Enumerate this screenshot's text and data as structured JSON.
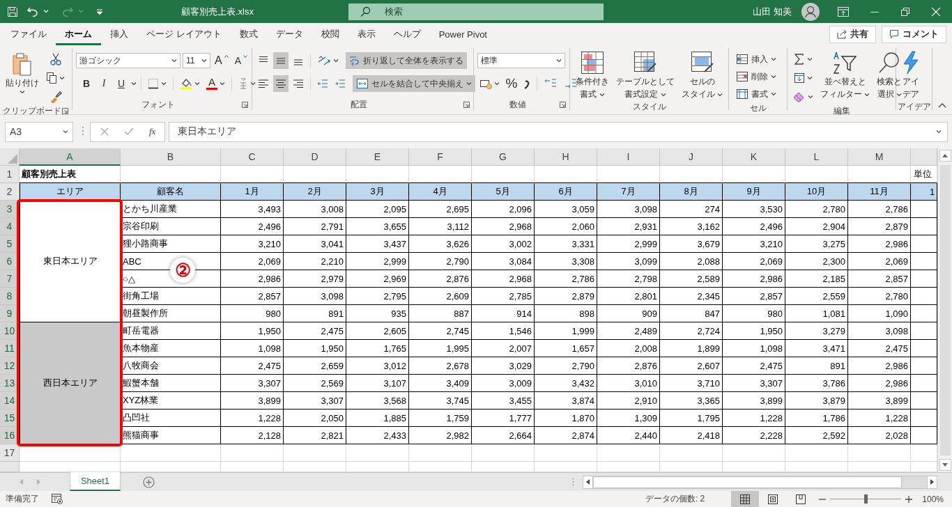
{
  "title_bar": {
    "file_name": "顧客別売上表.xlsx",
    "search": {
      "placeholder": "検索"
    },
    "user_name": "山田 知美"
  },
  "menu_tabs": [
    {
      "label": "ファイル",
      "selected": false
    },
    {
      "label": "ホーム",
      "selected": true
    },
    {
      "label": "挿入",
      "selected": false
    },
    {
      "label": "ページ レイアウト",
      "selected": false
    },
    {
      "label": "数式",
      "selected": false
    },
    {
      "label": "データ",
      "selected": false
    },
    {
      "label": "校閲",
      "selected": false
    },
    {
      "label": "表示",
      "selected": false
    },
    {
      "label": "ヘルプ",
      "selected": false
    },
    {
      "label": "Power Pivot",
      "selected": false
    }
  ],
  "share_button": "共有",
  "comment_button": "コメント",
  "ribbon": {
    "groups": [
      {
        "kind": "clipboard",
        "label": "クリップボード",
        "paste": "貼り付け"
      },
      {
        "kind": "font",
        "label": "フォント",
        "font_name": "游ゴシック",
        "font_size": "11",
        "grow": "A",
        "shrink": "A",
        "styles": [
          "B",
          "I",
          "U"
        ],
        "font_color": "A"
      },
      {
        "kind": "alignment",
        "label": "配置",
        "vertical": [
          {
            "selected": false
          },
          {
            "selected": true
          },
          {
            "selected": false
          }
        ],
        "horizontal": [
          {
            "selected": false
          },
          {
            "selected": true
          },
          {
            "selected": false
          }
        ],
        "wrap_text": {
          "label": "折り返して全体を表示する",
          "on": true
        },
        "merge": {
          "label": "セルを結合して中央揃え",
          "on": true
        }
      },
      {
        "kind": "number",
        "label": "数値",
        "format": "標準",
        "percent": "%"
      },
      {
        "kind": "styles",
        "label": "スタイル",
        "buttons": [
          {
            "lines": [
              "条件付き",
              "書式"
            ]
          },
          {
            "lines": [
              "テーブルとして",
              "書式設定"
            ]
          },
          {
            "lines": [
              "セルの",
              "スタイル"
            ]
          }
        ]
      },
      {
        "kind": "cells",
        "label": "セル",
        "buttons": [
          "挿入",
          "削除",
          "書式"
        ]
      },
      {
        "kind": "editing",
        "label": "編集",
        "buttons": [
          {
            "lines": [
              "並べ替えと",
              "フィルター"
            ]
          },
          {
            "lines": [
              "検索と",
              "選択"
            ]
          }
        ]
      },
      {
        "kind": "ideas",
        "label": "アイデア",
        "buttons": [
          {
            "lines": [
              "アイ",
              "デア"
            ]
          }
        ]
      }
    ]
  },
  "formula_bar": {
    "name_box": "A3",
    "function_label": "fx",
    "formula": "東日本エリア"
  },
  "sheet": {
    "columns": [
      {
        "label": "A",
        "selected": true
      },
      {
        "label": "B",
        "selected": false
      },
      {
        "label": "C",
        "selected": false
      },
      {
        "label": "D",
        "selected": false
      },
      {
        "label": "E",
        "selected": false
      },
      {
        "label": "F",
        "selected": false
      },
      {
        "label": "G",
        "selected": false
      },
      {
        "label": "H",
        "selected": false
      },
      {
        "label": "I",
        "selected": false
      },
      {
        "label": "J",
        "selected": false
      },
      {
        "label": "K",
        "selected": false
      },
      {
        "label": "L",
        "selected": false
      },
      {
        "label": "M",
        "selected": false
      }
    ],
    "title_row": {
      "number": "1",
      "selected": false,
      "title": "顧客別売上表",
      "unit": "単位"
    },
    "header_row": {
      "number": "2",
      "selected": false,
      "cells": [
        "エリア",
        "顧客名",
        "1月",
        "2月",
        "3月",
        "4月",
        "5月",
        "6月",
        "7月",
        "8月",
        "9月",
        "10月",
        "11月",
        "1"
      ]
    },
    "areas": [
      {
        "name": "東日本エリア",
        "shaded": false,
        "rows": [
          {
            "number": "3",
            "selected": true,
            "customer": "とかち川産業",
            "values": [
              "3,493",
              "3,008",
              "2,095",
              "2,695",
              "2,096",
              "3,059",
              "3,098",
              "274",
              "3,530",
              "2,780",
              "2,786"
            ]
          },
          {
            "number": "4",
            "selected": true,
            "customer": "宗谷印刷",
            "values": [
              "2,496",
              "2,791",
              "3,655",
              "3,112",
              "2,968",
              "2,060",
              "2,931",
              "3,162",
              "2,496",
              "2,904",
              "2,879"
            ]
          },
          {
            "number": "5",
            "selected": true,
            "customer": "狸小路商事",
            "values": [
              "3,210",
              "3,041",
              "3,437",
              "3,626",
              "3,002",
              "3,331",
              "2,999",
              "3,679",
              "3,210",
              "3,275",
              "2,986"
            ]
          },
          {
            "number": "6",
            "selected": true,
            "customer": "ABC",
            "values": [
              "2,069",
              "2,210",
              "2,999",
              "2,790",
              "3,084",
              "3,308",
              "3,099",
              "2,088",
              "2,069",
              "2,300",
              "2,069"
            ]
          },
          {
            "number": "7",
            "selected": true,
            "customer": "○△",
            "values": [
              "2,986",
              "2,979",
              "2,969",
              "2,876",
              "2,968",
              "2,786",
              "2,798",
              "2,589",
              "2,986",
              "2,185",
              "2,857"
            ]
          },
          {
            "number": "8",
            "selected": true,
            "customer": "街角工場",
            "values": [
              "2,857",
              "3,098",
              "2,795",
              "2,609",
              "2,785",
              "2,879",
              "2,801",
              "2,345",
              "2,857",
              "2,559",
              "2,780"
            ]
          },
          {
            "number": "9",
            "selected": true,
            "customer": "朝昼製作所",
            "values": [
              "980",
              "891",
              "935",
              "887",
              "914",
              "898",
              "909",
              "847",
              "980",
              "1,081",
              "1,090"
            ]
          }
        ]
      },
      {
        "name": "西日本エリア",
        "shaded": true,
        "rows": [
          {
            "number": "10",
            "selected": true,
            "customer": "町岳電器",
            "values": [
              "1,950",
              "2,475",
              "2,605",
              "2,745",
              "1,546",
              "1,999",
              "2,489",
              "2,724",
              "1,950",
              "3,279",
              "3,098"
            ]
          },
          {
            "number": "11",
            "selected": true,
            "customer": "魚本物産",
            "values": [
              "1,098",
              "1,950",
              "1,765",
              "1,995",
              "2,007",
              "1,657",
              "2,008",
              "1,899",
              "1,098",
              "3,471",
              "2,475"
            ]
          },
          {
            "number": "12",
            "selected": true,
            "customer": "八牧商会",
            "values": [
              "2,475",
              "2,659",
              "3,012",
              "2,678",
              "3,029",
              "2,790",
              "2,876",
              "2,607",
              "2,475",
              "891",
              "2,986"
            ]
          },
          {
            "number": "13",
            "selected": true,
            "customer": "鰕蟹本舗",
            "values": [
              "3,307",
              "2,569",
              "3,107",
              "3,409",
              "3,009",
              "3,432",
              "3,010",
              "3,710",
              "3,307",
              "3,786",
              "2,986"
            ]
          },
          {
            "number": "14",
            "selected": true,
            "customer": "XYZ林業",
            "values": [
              "3,899",
              "3,307",
              "3,568",
              "3,745",
              "3,455",
              "3,874",
              "2,910",
              "3,365",
              "3,899",
              "3,879",
              "3,899"
            ]
          },
          {
            "number": "15",
            "selected": true,
            "customer": "凸凹社",
            "values": [
              "1,228",
              "2,050",
              "1,885",
              "1,759",
              "1,777",
              "1,870",
              "1,309",
              "1,795",
              "1,228",
              "1,786",
              "1,228"
            ]
          },
          {
            "number": "16",
            "selected": true,
            "customer": "熊猫商事",
            "values": [
              "2,128",
              "2,821",
              "2,433",
              "2,982",
              "2,664",
              "2,874",
              "2,440",
              "2,418",
              "2,228",
              "2,592",
              "2,028"
            ]
          }
        ]
      }
    ],
    "empty_rows": [
      {
        "number": "17",
        "selected": false
      }
    ],
    "annotation": {
      "label": "②",
      "frame": true
    }
  },
  "sheet_tabs": [
    {
      "label": "Sheet1",
      "selected": true
    }
  ],
  "status_bar": {
    "status": "準備完了",
    "summary": "データの個数: 2",
    "views": [
      {
        "selected": true
      },
      {
        "selected": false
      },
      {
        "selected": false
      }
    ],
    "zoom": {
      "level": 0.5,
      "reading": "100%"
    }
  }
}
